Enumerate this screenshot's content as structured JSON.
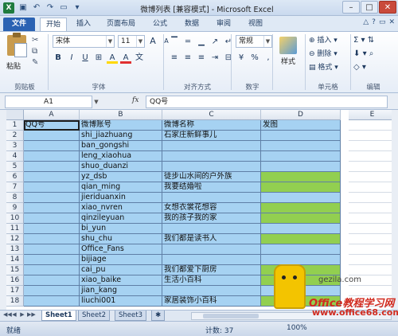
{
  "window": {
    "title": "微博列表 [兼容模式] - Microsoft Excel",
    "logo": "X",
    "buttons": {
      "minimize": "–",
      "maximize": "□",
      "close": "✕"
    }
  },
  "ribbon_tabs": {
    "file": "文件",
    "items": [
      "开始",
      "插入",
      "页面布局",
      "公式",
      "数据",
      "审阅",
      "视图"
    ],
    "active": "开始"
  },
  "ribbon": {
    "clipboard": {
      "paste": "粘贴",
      "label": "剪贴板"
    },
    "font": {
      "name": "宋体",
      "size": "11",
      "bold": "B",
      "italic": "I",
      "underline": "U",
      "grow": "A",
      "shrink": "A",
      "fill": "A",
      "color": "A",
      "label": "字体",
      "wen": "文"
    },
    "alignment": {
      "label": "对齐方式"
    },
    "number": {
      "format": "常规",
      "percent": "%",
      "comma": ",",
      "currency": "¥",
      "label": "数字"
    },
    "styles": {
      "button": "样式"
    },
    "cells": {
      "insert": "插入",
      "delete": "删除",
      "format": "格式",
      "label": "单元格"
    },
    "editing": {
      "sum": "Σ",
      "label": "编辑"
    }
  },
  "formula_bar": {
    "name_box": "A1",
    "fx": "fx",
    "content": "QQ号"
  },
  "columns": [
    "A",
    "B",
    "C",
    "D",
    "E"
  ],
  "rows": [
    {
      "n": "1",
      "a": "QQ号",
      "b": "微博账号",
      "c": "微博名称",
      "d": "发图",
      "d_fill": "blue"
    },
    {
      "n": "2",
      "a": "",
      "b": "shi_jiazhuang",
      "c": "石家庄新鲜事儿",
      "d": "",
      "d_fill": "blue"
    },
    {
      "n": "3",
      "a": "",
      "b": "ban_gongshi",
      "c": "",
      "d": "",
      "d_fill": "blue"
    },
    {
      "n": "4",
      "a": "",
      "b": "leng_xiaohua",
      "c": "",
      "d": "",
      "d_fill": "blue"
    },
    {
      "n": "5",
      "a": "",
      "b": "shuo_duanzi",
      "c": "",
      "d": "",
      "d_fill": "blue"
    },
    {
      "n": "6",
      "a": "",
      "b": "yz_dsb",
      "c": "徒步山水间的户外族",
      "d": "",
      "d_fill": "green"
    },
    {
      "n": "7",
      "a": "",
      "b": "qian_ming",
      "c": "我要结婚啦",
      "d": "",
      "d_fill": "green"
    },
    {
      "n": "8",
      "a": "",
      "b": "jieriduanxin",
      "c": "",
      "d": "",
      "d_fill": "blue"
    },
    {
      "n": "9",
      "a": "",
      "b": "xiao_nvren",
      "c": "女想衣裳花想容",
      "d": "",
      "d_fill": "green"
    },
    {
      "n": "10",
      "a": "",
      "b": "qinzileyuan",
      "c": "我的孩子我的家",
      "d": "",
      "d_fill": "green"
    },
    {
      "n": "11",
      "a": "",
      "b": "bi_yun",
      "c": "",
      "d": "",
      "d_fill": "blue"
    },
    {
      "n": "12",
      "a": "",
      "b": "shu_chu",
      "c": "我们都是读书人",
      "d": "",
      "d_fill": "green"
    },
    {
      "n": "13",
      "a": "",
      "b": "Office_Fans",
      "c": "",
      "d": "",
      "d_fill": "blue"
    },
    {
      "n": "14",
      "a": "",
      "b": "bijiage",
      "c": "",
      "d": "",
      "d_fill": "blue"
    },
    {
      "n": "15",
      "a": "",
      "b": "cai_pu",
      "c": "我们都爱下厨房",
      "d": "",
      "d_fill": "green"
    },
    {
      "n": "16",
      "a": "",
      "b": "xiao_baike",
      "c": "生活小百科",
      "d": "",
      "d_fill": "green"
    },
    {
      "n": "17",
      "a": "",
      "b": "jian_kang",
      "c": "",
      "d": "",
      "d_fill": "blue"
    },
    {
      "n": "18",
      "a": "",
      "b": "liuchi001",
      "c": "家居装饰小百科",
      "d": "",
      "d_fill": "green"
    }
  ],
  "sheets": [
    "Sheet1",
    "Sheet2",
    "Sheet3"
  ],
  "status": {
    "ready": "就绪",
    "count": "计数: 37",
    "zoom": "100%"
  },
  "watermark": {
    "site1": "gezila.com",
    "brand": "Office教程学习网",
    "site2": "www.office68.com"
  },
  "colors": {
    "blue_fill": "#a6d2f2",
    "green_fill": "#92cf50",
    "file_tab": "#2a62b3"
  }
}
